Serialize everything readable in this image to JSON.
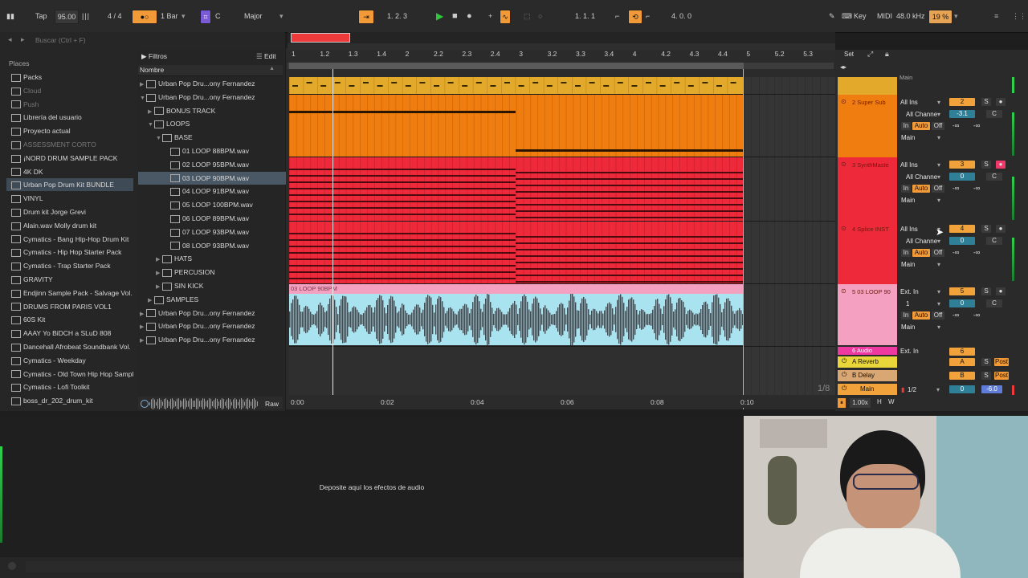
{
  "transport": {
    "tap": "Tap",
    "tempo": "95.00",
    "signature": "4 / 4",
    "quant": "1 Bar",
    "key": "C",
    "scale": "Major",
    "position": "1.  2.  3",
    "loop_start": "1.  1.  1",
    "loop_len": "4.  0.  0",
    "key_label": "Key",
    "midi_label": "MIDI",
    "sample_rate": "48.0 kHz",
    "cpu": "19 %"
  },
  "browser": {
    "search_placeholder": "Buscar (Ctrl + F)",
    "places_title": "Places",
    "places": [
      {
        "label": "Packs",
        "state": "normal"
      },
      {
        "label": "Cloud",
        "state": "dim"
      },
      {
        "label": "Push",
        "state": "dim"
      },
      {
        "label": "Librería del usuario",
        "state": "normal"
      },
      {
        "label": "Proyecto actual",
        "state": "normal"
      },
      {
        "label": "ASSESSMENT CORTO",
        "state": "dim"
      },
      {
        "label": "¡NORD DRUM SAMPLE PACK",
        "state": "normal"
      },
      {
        "label": "4K DK",
        "state": "normal"
      },
      {
        "label": "Urban Pop Drum Kit BUNDLE",
        "state": "selected"
      },
      {
        "label": "VINYL",
        "state": "normal"
      },
      {
        "label": "Drum kit Jorge Grevi",
        "state": "normal"
      },
      {
        "label": "Alain.wav Molly drum kit",
        "state": "normal"
      },
      {
        "label": "Cymatics - Bang Hip-Hop Drum Kit",
        "state": "normal"
      },
      {
        "label": "Cymatics - Hip Hop Starter Pack",
        "state": "normal"
      },
      {
        "label": "Cymatics - Trap Starter Pack",
        "state": "normal"
      },
      {
        "label": "GRAVITY",
        "state": "normal"
      },
      {
        "label": "Endjinn Sample Pack - Salvage Vol.",
        "state": "normal"
      },
      {
        "label": "DRUMS FROM PARIS VOL1",
        "state": "normal"
      },
      {
        "label": "60S Kit",
        "state": "normal"
      },
      {
        "label": "AAAY Yo BiDCH a SLuD 808",
        "state": "normal"
      },
      {
        "label": "Dancehall Afrobeat Soundbank Vol.",
        "state": "normal"
      },
      {
        "label": "Cymatics - Weekday",
        "state": "normal"
      },
      {
        "label": "Cymatics - Old Town Hip Hop Sampl",
        "state": "normal"
      },
      {
        "label": "Cymatics - Lofi Toolkit",
        "state": "normal"
      },
      {
        "label": "boss_dr_202_drum_kit",
        "state": "normal"
      }
    ],
    "filters_label": "Filtros",
    "edit_label": "Edit",
    "name_header": "Nombre",
    "raw_label": "Raw",
    "tree": [
      {
        "label": "Urban Pop Dru...ony Fernandez",
        "depth": 0,
        "type": "folder",
        "open": false
      },
      {
        "label": "Urban Pop Dru...ony Fernandez",
        "depth": 0,
        "type": "folder",
        "open": true
      },
      {
        "label": "BONUS TRACK",
        "depth": 1,
        "type": "folder",
        "open": false
      },
      {
        "label": "LOOPS",
        "depth": 1,
        "type": "folder",
        "open": true
      },
      {
        "label": "BASE",
        "depth": 2,
        "type": "folder",
        "open": true
      },
      {
        "label": "01 LOOP 88BPM.wav",
        "depth": 3,
        "type": "file"
      },
      {
        "label": "02 LOOP 95BPM.wav",
        "depth": 3,
        "type": "file"
      },
      {
        "label": "03 LOOP 90BPM.wav",
        "depth": 3,
        "type": "file",
        "selected": true
      },
      {
        "label": "04 LOOP 91BPM.wav",
        "depth": 3,
        "type": "file"
      },
      {
        "label": "05 LOOP 100BPM.wav",
        "depth": 3,
        "type": "file"
      },
      {
        "label": "06 LOOP 89BPM.wav",
        "depth": 3,
        "type": "file"
      },
      {
        "label": "07 LOOP 93BPM.wav",
        "depth": 3,
        "type": "file"
      },
      {
        "label": "08 LOOP 93BPM.wav",
        "depth": 3,
        "type": "file"
      },
      {
        "label": "HATS",
        "depth": 2,
        "type": "folder",
        "open": false
      },
      {
        "label": "PERCUSION",
        "depth": 2,
        "type": "folder",
        "open": false
      },
      {
        "label": "SIN KICK",
        "depth": 2,
        "type": "folder",
        "open": false
      },
      {
        "label": "SAMPLES",
        "depth": 1,
        "type": "folder",
        "open": false
      },
      {
        "label": "Urban Pop Dru...ony Fernandez",
        "depth": 0,
        "type": "folder",
        "open": false
      },
      {
        "label": "Urban Pop Dru...ony Fernandez",
        "depth": 0,
        "type": "folder",
        "open": false
      },
      {
        "label": "Urban Pop Dru...ony Fernandez",
        "depth": 0,
        "type": "folder",
        "open": false
      }
    ]
  },
  "arrangement": {
    "bar_labels": [
      "1",
      "1.2",
      "1.3",
      "1.4",
      "2",
      "2.2",
      "2.3",
      "2.4",
      "3",
      "3.2",
      "3.3",
      "3.4",
      "4",
      "4.2",
      "4.3",
      "4.4",
      "5",
      "5.2",
      "5.3"
    ],
    "time_labels": [
      "0:00",
      "0:02",
      "0:04",
      "0:06",
      "0:08",
      "0:10"
    ],
    "audio_clip_name": "03 LOOP 90BPM",
    "zoom_label": "1/8"
  },
  "mixer": {
    "set_label": "Set",
    "tracks": [
      {
        "name": "2 Super Sub",
        "color": "#f07d10",
        "input": "All Ins",
        "channel": "All Channe",
        "monitor_in": "In",
        "monitor_auto": "Auto",
        "monitor_off": "Off",
        "output": "Main",
        "number": "2",
        "solo": "S",
        "volume": "-3.1",
        "pan": "C",
        "sends": "-∞"
      },
      {
        "name": "3 SynthMaste",
        "color": "#ee2a3a",
        "input": "All Ins",
        "channel": "All Channe",
        "monitor_in": "In",
        "monitor_auto": "Auto",
        "monitor_off": "Off",
        "output": "Main",
        "number": "3",
        "solo": "S",
        "volume": "0",
        "pan": "C",
        "sends": "-∞"
      },
      {
        "name": "4 Splice INST",
        "color": "#ee2a3a",
        "input": "All Ins",
        "channel": "All Channe",
        "monitor_in": "In",
        "monitor_auto": "Auto",
        "monitor_off": "Off",
        "output": "Main",
        "number": "4",
        "solo": "S",
        "volume": "0",
        "pan": "C",
        "sends": "-∞"
      },
      {
        "name": "5 03 LOOP 90",
        "color": "#f4a0c0",
        "input": "Ext. In",
        "channel": "1",
        "monitor_in": "In",
        "monitor_auto": "Auto",
        "monitor_off": "Off",
        "output": "Main",
        "number": "5",
        "solo": "S",
        "volume": "0",
        "pan": "C",
        "sends": "-∞"
      }
    ],
    "partial_track": "6 Audio",
    "partial_input": "Ext. In",
    "partial_number": "6",
    "returns": [
      {
        "name": "A Reverb",
        "letter": "A",
        "post": "Post",
        "color": "#e8d63a"
      },
      {
        "name": "B Delay",
        "letter": "B",
        "post": "Post",
        "color": "#d8a774"
      }
    ],
    "main": {
      "name": "Main",
      "output": "1/2",
      "volume": "0",
      "gain": "-6.0",
      "color": "#f2a23a"
    },
    "zoom": "1.00x",
    "h_label": "H",
    "w_label": "W"
  },
  "devices": {
    "drop_hint": "Deposite aquí los efectos de audio"
  },
  "colors": {
    "yellow_clip": "#e3a92b",
    "orange_clip": "#f07d10",
    "red_clip": "#ee2a3a",
    "audio_clip": "#a9e3ef",
    "audio_header": "#f4a0c0"
  }
}
